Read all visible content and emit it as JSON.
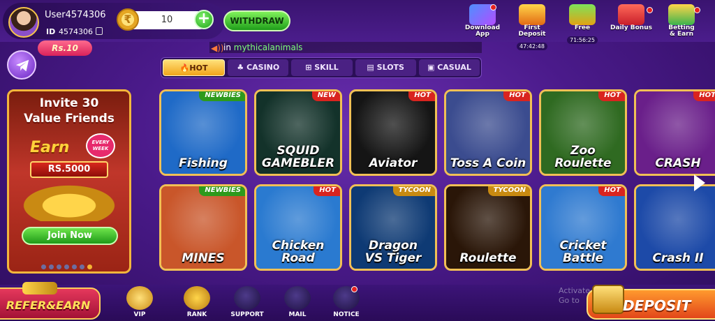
{
  "user": {
    "username": "User4574306",
    "id_label": "ID",
    "id": "4574306"
  },
  "wallet": {
    "balance": "10",
    "withdraw_label": "WITHDRAW",
    "add_symbol": "+"
  },
  "top_icons": [
    {
      "label": "Download\nApp"
    },
    {
      "label": "First Deposit",
      "timer": "47:42:48"
    },
    {
      "label": "Free",
      "timer": "71:56:25"
    },
    {
      "label": "Daily Bonus"
    },
    {
      "label": "Betting\n& Earn"
    }
  ],
  "reward_tag": "Rs.10",
  "marquee": {
    "prefix": "in ",
    "highlight": "mythicalanimals"
  },
  "tabs": [
    "HOT",
    "CASINO",
    "SKILL",
    "SLOTS",
    "CASUAL"
  ],
  "invite_banner": {
    "title": "Invite 30\nValue Friends",
    "earn": "Earn",
    "every_week": "EVERY WEEK",
    "amount": "RS.5000",
    "join_label": "Join Now"
  },
  "games": [
    {
      "title": "Fishing",
      "badge": "NEWBIES",
      "badge_type": "newbies",
      "bg": "#1f6ac7"
    },
    {
      "title": "SQUID\nGAMEBLER",
      "badge": "NEW",
      "badge_type": "new",
      "bg": "#13322a"
    },
    {
      "title": "Aviator",
      "badge": "HOT",
      "badge_type": "hot",
      "bg": "#151515"
    },
    {
      "title": "Toss A Coin",
      "badge": "HOT",
      "badge_type": "hot",
      "bg": "#3b4c8f"
    },
    {
      "title": "Zoo\nRoulette",
      "badge": "HOT",
      "badge_type": "hot",
      "bg": "#2f6a21"
    },
    {
      "title": "CRASH",
      "badge": "HOT",
      "badge_type": "hot",
      "bg": "#6a1f8a"
    },
    {
      "title": "MINES",
      "badge": "NEWBIES",
      "badge_type": "newbies",
      "bg": "#c9562a"
    },
    {
      "title": "Chicken\nRoad",
      "badge": "HOT",
      "badge_type": "hot",
      "bg": "#2a7ad0"
    },
    {
      "title": "Dragon\nVS Tiger",
      "badge": "TYCOON",
      "badge_type": "tycoon",
      "bg": "#0e3a74"
    },
    {
      "title": "Roulette",
      "badge": "TYCOON",
      "badge_type": "tycoon",
      "bg": "#2a1608"
    },
    {
      "title": "Cricket\nBattle",
      "badge": "HOT",
      "badge_type": "hot",
      "bg": "#2f7ad0"
    },
    {
      "title": "Crash II",
      "badge": "",
      "badge_type": "",
      "bg": "#1d4aa8"
    }
  ],
  "bottom_nav": {
    "refer": "REFER&EARN",
    "items": [
      "VIP",
      "RANK",
      "SUPPORT",
      "MAIL",
      "NOTICE"
    ],
    "deposit": "DEPOSIT"
  },
  "watermark": {
    "line1": "Activate Windows",
    "line2": "Go to"
  },
  "colors": {
    "accent_gold": "#f1c055",
    "hot_red": "#d9241f",
    "newbies_green": "#2d9a1c",
    "tycoon_orange": "#c88a11"
  }
}
